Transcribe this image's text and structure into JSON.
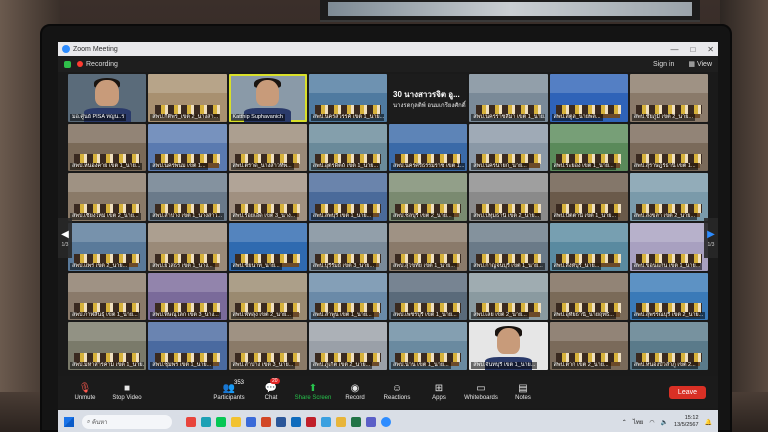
{
  "window": {
    "title": "Zoom Meeting",
    "controls": [
      "—",
      "□",
      "✕"
    ]
  },
  "topbar": {
    "recording": "Recording",
    "signin": "Sign in",
    "view": "View"
  },
  "grid": {
    "title_tile": {
      "line1": "30 นางสาวรจิต อู...",
      "line2": "นางรดกุลติพ์ อนมเกรียงศักดิ์"
    },
    "tiles": [
      {
        "name": "มอ.ศูนย์ PISA ทญน..ร",
        "kind": "person",
        "bg": "#5a6b7a"
      },
      {
        "name": "สพป.กิติพร_เขต 2_นางสา...",
        "kind": "room",
        "bg": "#a89070"
      },
      {
        "name": "Katthip Suphavanich",
        "kind": "person",
        "bg": "#8a9aa8",
        "active": true
      },
      {
        "name": "สพป.นครสวรรค์ เขต 1_นาย...",
        "kind": "room",
        "bg": "#4f7aa0"
      },
      {
        "name": "",
        "kind": "title",
        "bg": "#1c1c1c"
      },
      {
        "name": "สพป.นครราชสีมา เขต 1_นาย...",
        "kind": "room",
        "bg": "#7a8a98"
      },
      {
        "name": "สพป.สตูล_นายพล...",
        "kind": "room",
        "bg": "#2f63b8"
      },
      {
        "name": "สพป.ชัยภูมิ เขต 2_นาย...",
        "kind": "room",
        "bg": "#8a7a6a"
      },
      {
        "name": "สพป.หนองคาย เขต 1_นาย...",
        "kind": "room",
        "bg": "#7a6a58"
      },
      {
        "name": "สพป.นครพนม เขต 1...",
        "kind": "room",
        "bg": "#5a7ab0"
      },
      {
        "name": "สพป.ตราด_นางสาวทิพ...",
        "kind": "room",
        "bg": "#9a8a78"
      },
      {
        "name": "สพป.อุตรดิตถ์ เขต 1_นาย...",
        "kind": "room",
        "bg": "#6a8a9a"
      },
      {
        "name": "สพป.นครศรีธรรมราช เขต 1...",
        "kind": "room",
        "bg": "#3a6aa8"
      },
      {
        "name": "สพป.นครนายก_นาย...",
        "kind": "room",
        "bg": "#8a98a6"
      },
      {
        "name": "สพป.ระยอง เขต 1_นาย...",
        "kind": "room",
        "bg": "#5a8a5a"
      },
      {
        "name": "สพป.สุราษฎร์ธานี เขต 1...",
        "kind": "room",
        "bg": "#7a6a5a"
      },
      {
        "name": "สพป.เชียงใหม่ เขต 2_นาย...",
        "kind": "room",
        "bg": "#8a7a68"
      },
      {
        "name": "สพป.ลำปาง เขต 1_นางสาว...",
        "kind": "room",
        "bg": "#6a7a8a"
      },
      {
        "name": "สพป.ร้อยเอ็ด เขต 3_นาง...",
        "kind": "room",
        "bg": "#a09080"
      },
      {
        "name": "สพป.ลพบุรี เขต 1_นาย...",
        "kind": "room",
        "bg": "#4a6a9a"
      },
      {
        "name": "สพป.ชลบุรี เขต 2_นาย...",
        "kind": "room",
        "bg": "#7a8a70"
      },
      {
        "name": "สพป.ปทุมธานี เขต 2_นาย...",
        "kind": "room",
        "bg": "#8a8a8a"
      },
      {
        "name": "สพป.ปัตตานี เขต 1_นาย...",
        "kind": "room",
        "bg": "#6a5a4a"
      },
      {
        "name": "สพป.สงขลา เขต 2_นาย...",
        "kind": "room",
        "bg": "#7a9aaa"
      },
      {
        "name": "สพป.แพร่ เขต 2_นาย...",
        "kind": "room",
        "bg": "#5a7a9a"
      },
      {
        "name": "สพป.ยโสธร เขต 1_นาง...",
        "kind": "room",
        "bg": "#9a8a78"
      },
      {
        "name": "สพป.ชัยนาท_นาย...",
        "kind": "room",
        "bg": "#2f6ab0"
      },
      {
        "name": "สพป.บุรีรัมย์ เขต 3_นาย...",
        "kind": "room",
        "bg": "#7a8a98"
      },
      {
        "name": "สพป.สุโขทัย เขต 1_นาย...",
        "kind": "room",
        "bg": "#8a7a6a"
      },
      {
        "name": "สพป.กาญจนบุรี เขต 1_นาย...",
        "kind": "room",
        "bg": "#6a7a88"
      },
      {
        "name": "สพป.สิงห์บุรี_นาย...",
        "kind": "room",
        "bg": "#5a8aa0"
      },
      {
        "name": "สพป.ขอนแก่น เขต 1_นาย...",
        "kind": "room",
        "bg": "#a8a0c0"
      },
      {
        "name": "สพป.กาฬสินธุ์ เขต 1_นาย...",
        "kind": "room",
        "bg": "#8a7a6a"
      },
      {
        "name": "สพป.พิษณุโลก เขต 3_นาง...",
        "kind": "room",
        "bg": "#7a6a9a"
      },
      {
        "name": "สพป.พัทลุง เขต 2_นาย...",
        "kind": "room",
        "bg": "#9a8a70"
      },
      {
        "name": "สพป.ลำพูน เขต 1_นาย...",
        "kind": "room",
        "bg": "#6a8aa8"
      },
      {
        "name": "สพป.เพชรบุรี เขต 1_นาย...",
        "kind": "room",
        "bg": "#5a6a7a"
      },
      {
        "name": "สพป.เลย เขต 2_นาย...",
        "kind": "room",
        "bg": "#8a9aa0"
      },
      {
        "name": "สพป.อุทัยธานี_นายฤทธิ...",
        "kind": "room",
        "bg": "#7a6a58"
      },
      {
        "name": "สพป.สุพรรณบุรี เขต 2_นาย...",
        "kind": "room",
        "bg": "#3a7ab8"
      },
      {
        "name": "สพป.มหาสารคาม เขต 1_นาย...",
        "kind": "room",
        "bg": "#7a7a6a"
      },
      {
        "name": "สพป.ชุมพร เขต 1_นาย...",
        "kind": "room",
        "bg": "#4a6aa0"
      },
      {
        "name": "สพป.ลำปาง เขต 3_นาย...",
        "kind": "room",
        "bg": "#8a7a68"
      },
      {
        "name": "สพป.ภูเก็ต เขต 2_นาย...",
        "kind": "room",
        "bg": "#9aa0a8"
      },
      {
        "name": "สพป.น่าน เขต 1_นาย...",
        "kind": "room",
        "bg": "#6a8aa0"
      },
      {
        "name": "สพป.จันทบุรี เขต 1_นาย...",
        "kind": "person",
        "bg": "#e6e6e6"
      },
      {
        "name": "สพป.ตาก เขต 2_นาย...",
        "kind": "room",
        "bg": "#7a6a5a"
      },
      {
        "name": "สพป.หนองบัวลำภู เขต 2...",
        "kind": "room",
        "bg": "#5a7a8a"
      }
    ],
    "pager_left": "1/3",
    "pager_right": "1/3"
  },
  "toolbar": {
    "unmute": "Unmute",
    "stop_video": "Stop Video",
    "participants": "Participants",
    "participants_count": "353",
    "chat": "Chat",
    "chat_badge": "20",
    "share_screen": "Share Screen",
    "record": "Record",
    "reactions": "Reactions",
    "apps": "Apps",
    "whiteboards": "Whiteboards",
    "notes": "Notes",
    "leave": "Leave"
  },
  "taskbar": {
    "search_placeholder": "ค้นหา",
    "lang": "ไทย",
    "time": "15:12",
    "date": "13/5/2567"
  },
  "colors": {
    "accent": "#2d8cff",
    "share_green": "#27c24c",
    "leave_red": "#d93025",
    "active_outline": "#d9e02a"
  }
}
